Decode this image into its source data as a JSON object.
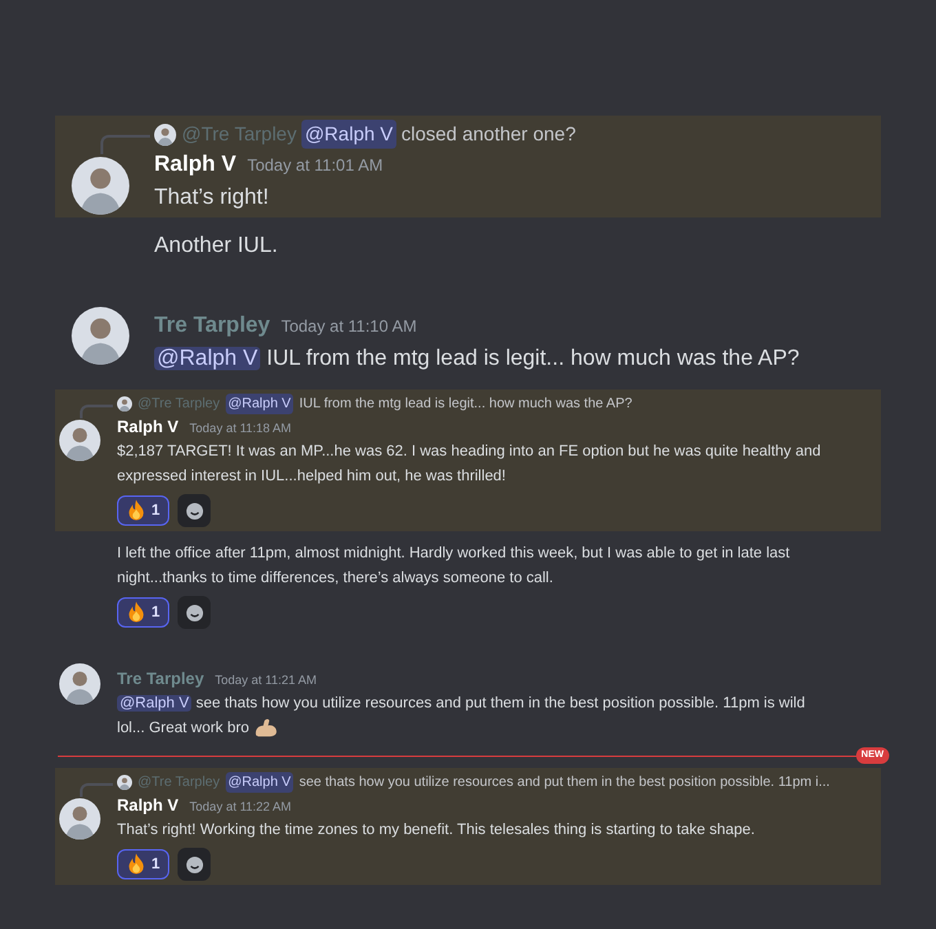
{
  "sections": [
    {
      "kind": "large",
      "messages": [
        {
          "kind": "message",
          "highlighted": true,
          "reply": {
            "author": "@Tre Tarpley",
            "mention": "@Ralph V",
            "text": "closed another one?"
          },
          "author": "Ralph V",
          "color": "#ffffff",
          "time": "Today at 11:01 AM",
          "text": "That’s right!"
        },
        {
          "kind": "continuation",
          "highlighted": false,
          "text": "Another IUL."
        },
        {
          "kind": "message",
          "highlighted": false,
          "author": "Tre Tarpley",
          "color": "#6f8a8e",
          "time": "Today at 11:10 AM",
          "mention": "@Ralph V",
          "text": "IUL from the mtg lead is legit... how much was the AP?"
        }
      ]
    },
    {
      "kind": "small",
      "messages": [
        {
          "kind": "message",
          "highlighted": true,
          "reply": {
            "author": "@Tre Tarpley",
            "mention": "@Ralph V",
            "text": "IUL from the mtg lead is legit... how much was the AP?"
          },
          "author": "Ralph V",
          "color": "#ffffff",
          "time": "Today at 11:18 AM",
          "text": "$2,187 TARGET! It was an MP...he was 62. I was heading into an FE option but he was quite healthy and expressed interest in IUL...helped him out, he was thrilled!",
          "reactions": [
            {
              "count": "1",
              "selected": true
            }
          ]
        },
        {
          "kind": "continuation",
          "highlighted": false,
          "text": "I left the office after 11pm, almost midnight. Hardly worked this week, but I was able to get in late last night...thanks to time differences, there’s always someone to call.",
          "reactions": [
            {
              "count": "1",
              "selected": true
            }
          ]
        },
        {
          "kind": "message",
          "highlighted": false,
          "author": "Tre Tarpley",
          "color": "#6f8a8e",
          "time": "Today at 11:21 AM",
          "mention": "@Ralph V",
          "text": "see thats how you utilize resources and put them in the best position possible. 11pm is wild lol... Great work bro",
          "icon": {
            "kind": "flexed-arm"
          }
        },
        {
          "kind": "divider",
          "label": "NEW"
        },
        {
          "kind": "message",
          "highlighted": true,
          "reply": {
            "author": "@Tre Tarpley",
            "mention": "@Ralph V",
            "text": "see thats how you utilize resources and put them in the best position possible. 11pm i..."
          },
          "author": "Ralph V",
          "color": "#ffffff",
          "time": "Today at 11:22 AM",
          "text": "That’s right! Working the time zones to my benefit. This telesales thing is starting to take shape.",
          "reactions": [
            {
              "count": "1",
              "selected": true
            }
          ]
        }
      ]
    }
  ]
}
